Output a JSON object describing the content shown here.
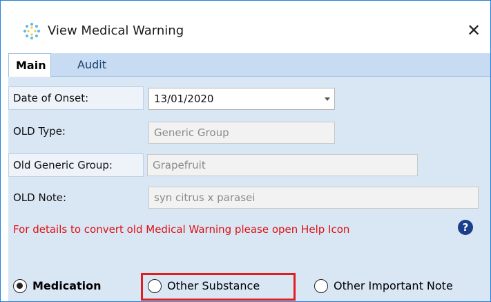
{
  "window": {
    "title": "View Medical Warning",
    "close_glyph": "✕"
  },
  "tabs": [
    {
      "label": "Main",
      "active": true
    },
    {
      "label": "Audit",
      "active": false
    }
  ],
  "form": {
    "date_of_onset": {
      "label": "Date of Onset:",
      "value": "13/01/2020"
    },
    "old_type": {
      "label": "OLD Type:",
      "value": "Generic Group"
    },
    "old_generic_group": {
      "label": "Old Generic Group:",
      "value": "Grapefruit"
    },
    "old_note": {
      "label": "OLD Note:",
      "value": "syn citrus x parasei"
    }
  },
  "warning_text": "For details to convert old Medical Warning please open Help Icon",
  "help_icon_glyph": "?",
  "radios": [
    {
      "label": "Medication",
      "checked": true
    },
    {
      "label": "Other Substance",
      "checked": false
    },
    {
      "label": "Other Important Note",
      "checked": false
    }
  ],
  "colors": {
    "accent": "#1f7fd9",
    "warning": "#e01010",
    "highlight": "#e41c1c",
    "panel": "#d9e6f4"
  }
}
